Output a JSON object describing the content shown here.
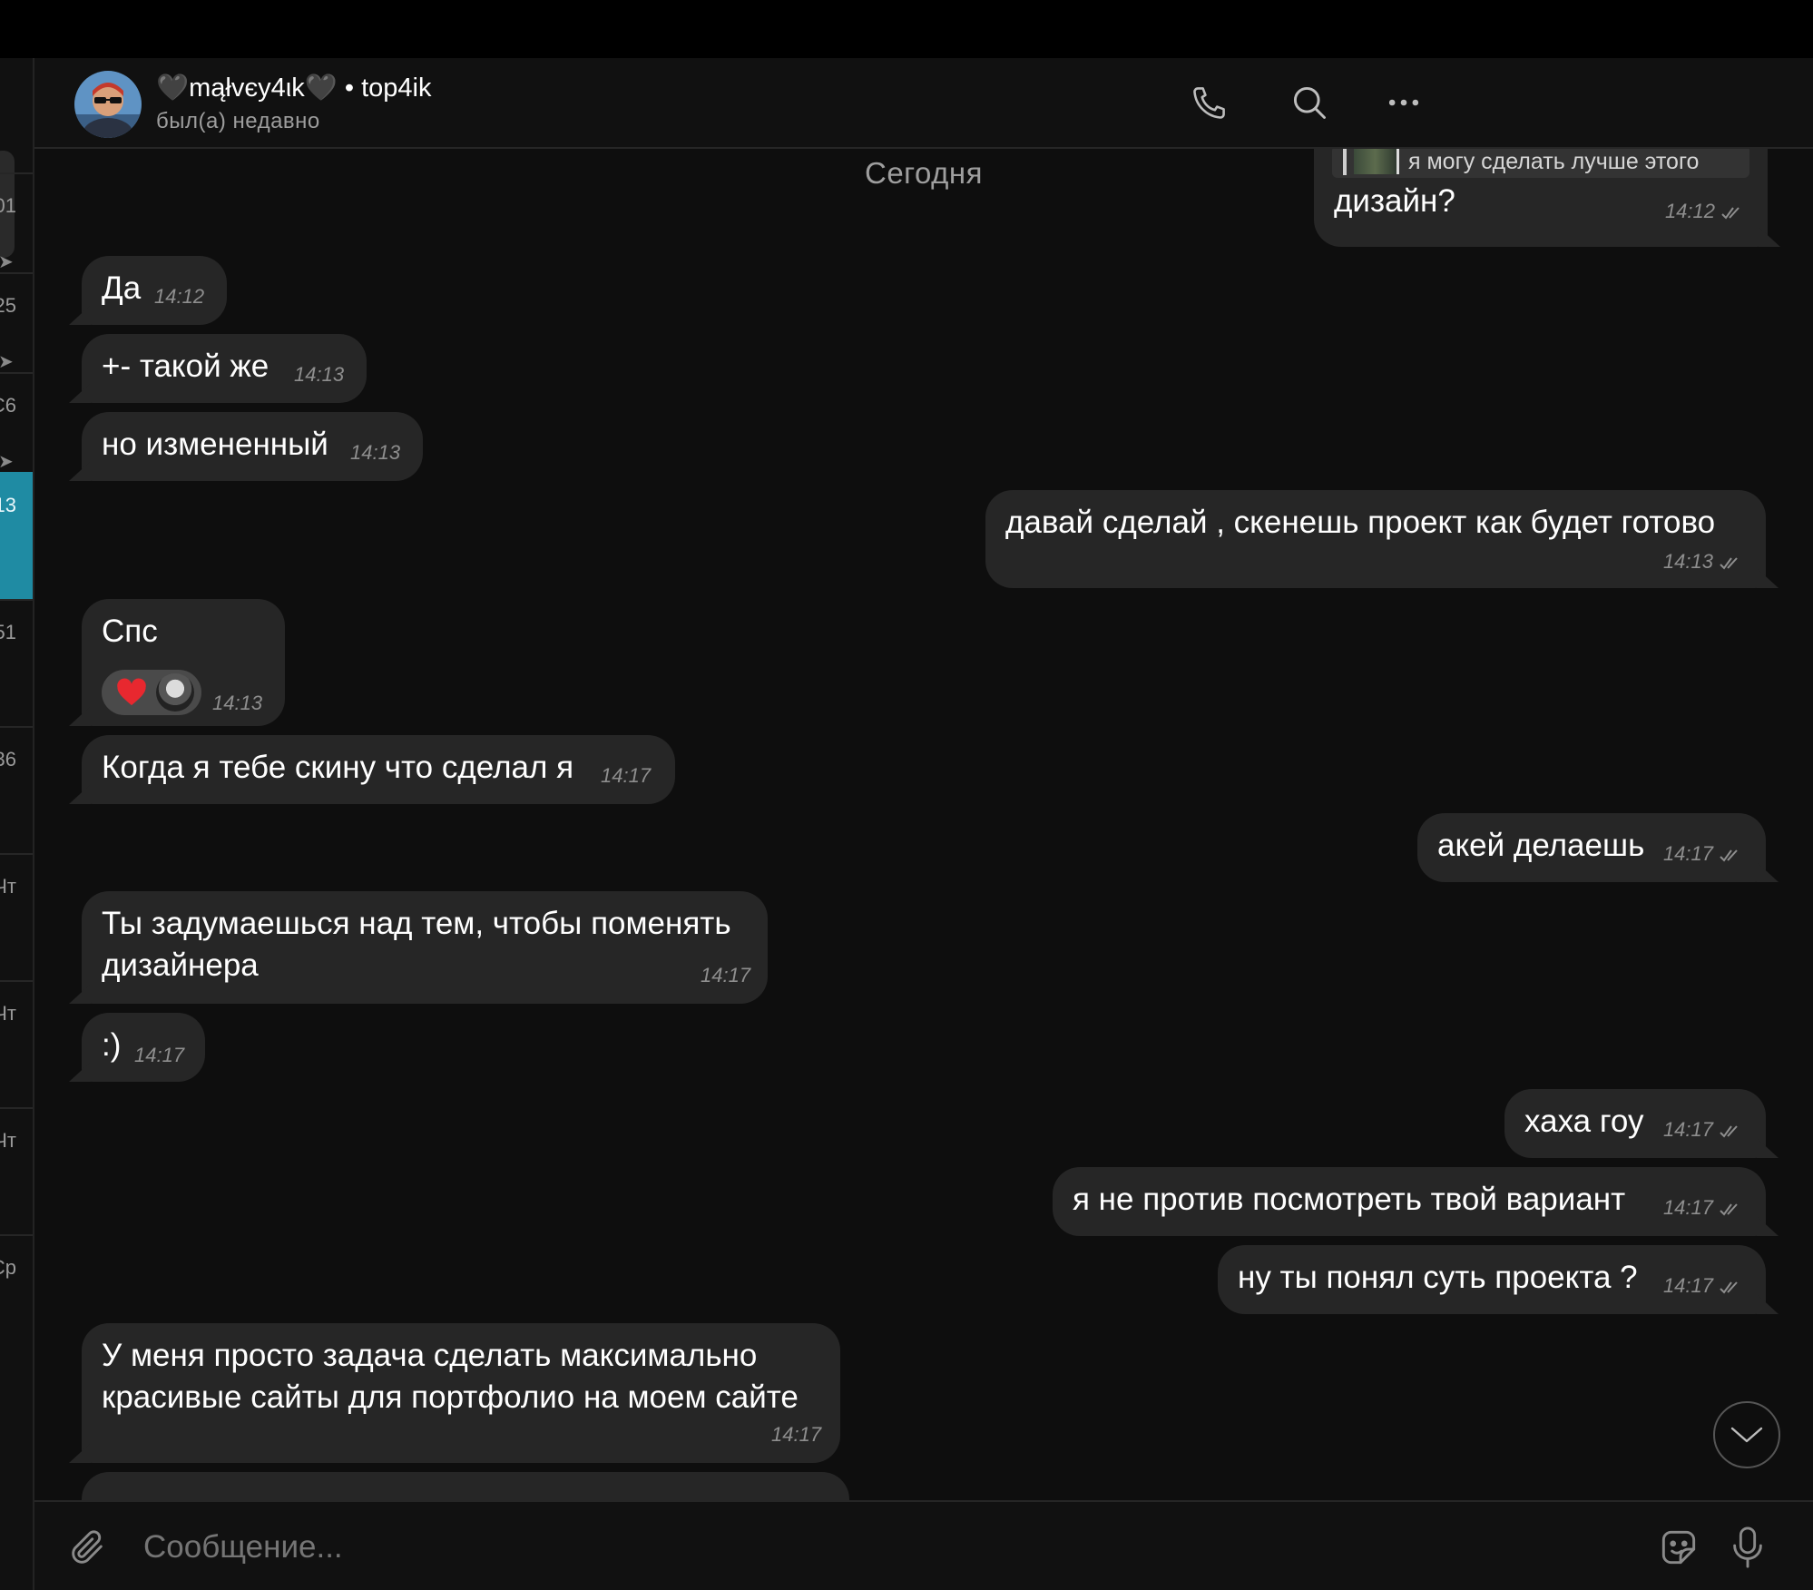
{
  "header": {
    "contact_name": "🖤mąłvєy4ιk🖤 • top4ik",
    "status": "был(а) недавно"
  },
  "sidebar": {
    "items": [
      {
        "time": "01",
        "pinned": true
      },
      {
        "time": "25",
        "pinned": true
      },
      {
        "time": "C6",
        "pinned": true
      },
      {
        "time": "13",
        "active": true
      },
      {
        "time": "51"
      },
      {
        "time": "36"
      },
      {
        "time": "Чт"
      },
      {
        "time": "Чт"
      },
      {
        "time": "Чт"
      },
      {
        "time": "Ср"
      }
    ]
  },
  "chat": {
    "date_separator": "Сегодня",
    "messages": [
      {
        "dir": "out",
        "reply_quote": "я могу сделать лучше этого",
        "text": "дизайн?",
        "time": "14:12"
      },
      {
        "dir": "in",
        "text": "Да",
        "time": "14:12"
      },
      {
        "dir": "in",
        "text": "+- такой же",
        "time": "14:13"
      },
      {
        "dir": "in",
        "text": "но измененный",
        "time": "14:13"
      },
      {
        "dir": "out",
        "text": "давай сделай , скенешь проект как будет готово",
        "time": "14:13"
      },
      {
        "dir": "in",
        "text": "Спс",
        "time": "14:13",
        "reaction": "heart"
      },
      {
        "dir": "in",
        "text": "Когда я тебе скину что сделал я",
        "time": "14:17"
      },
      {
        "dir": "out",
        "text": "акей делаешь",
        "time": "14:17"
      },
      {
        "dir": "in",
        "lines": [
          "Ты задумаешься над тем, чтобы поменять",
          "дизайнера"
        ],
        "time": "14:17"
      },
      {
        "dir": "in",
        "text": ":)",
        "time": "14:17"
      },
      {
        "dir": "out",
        "text": "хаха гоу",
        "time": "14:17"
      },
      {
        "dir": "out",
        "text": "я не против посмотреть твой вариант",
        "time": "14:17"
      },
      {
        "dir": "out",
        "text": "ну ты понял суть проекта ?",
        "time": "14:17"
      },
      {
        "dir": "in",
        "lines": [
          "У меня просто задача сделать максимально",
          "красивые сайты для портфолио на моем сайте"
        ],
        "time": "14:17"
      }
    ]
  },
  "input": {
    "placeholder": "Сообщение..."
  },
  "icons": {
    "header": [
      "phone-icon",
      "search-icon",
      "more-icon"
    ],
    "input": [
      "attach-icon",
      "sticker-icon",
      "microphone-icon"
    ],
    "scroll": "chevron-down-icon"
  },
  "colors": {
    "background": "#0e0e0e",
    "bubble": "#262626",
    "active_chat": "#1f8ba3",
    "reaction_heart": "#e8282f"
  }
}
